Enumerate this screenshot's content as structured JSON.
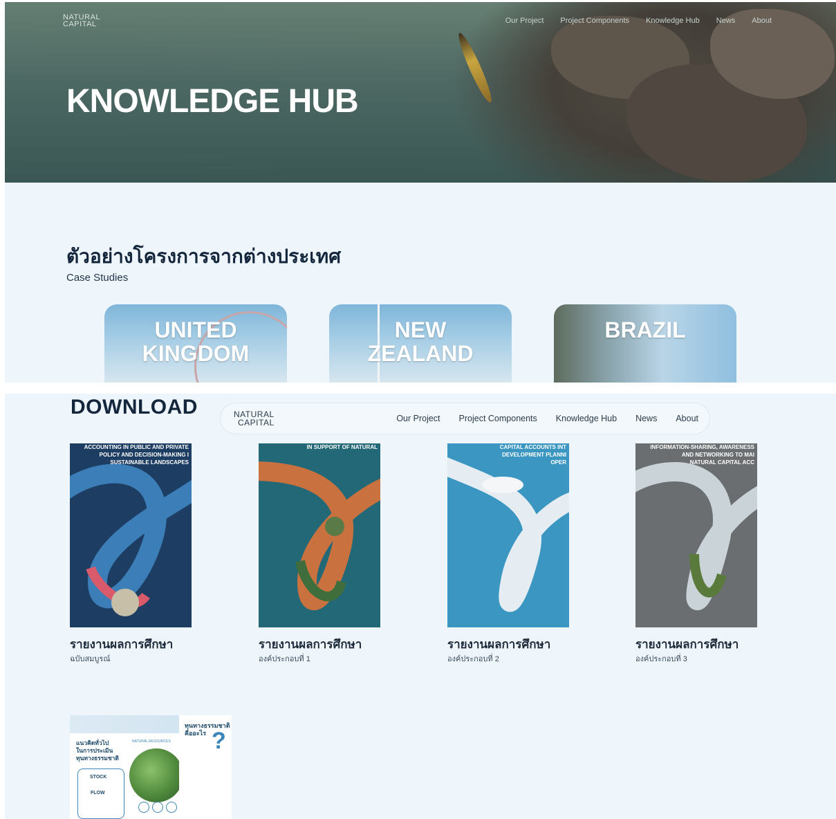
{
  "top": {
    "logo": {
      "line1": "NATURAL",
      "line2": "CAPITAL"
    },
    "nav": [
      "Our Project",
      "Project Components",
      "Knowledge Hub",
      "News",
      "About"
    ],
    "hero_title": "KNOWLEDGE HUB",
    "case_studies": {
      "title": "ตัวอย่างโครงการจากต่างประเทศ",
      "subtitle": "Case Studies",
      "cards": [
        {
          "line1": "UNITED",
          "line2": "KINGDOM"
        },
        {
          "line1": "NEW",
          "line2": "ZEALAND"
        },
        {
          "line1": "BRAZIL",
          "line2": ""
        }
      ]
    }
  },
  "bottom": {
    "download_title": "DOWNLOAD",
    "logo": {
      "line1": "NATURAL",
      "line2": "CAPITAL"
    },
    "nav": [
      "Our Project",
      "Project Components",
      "Knowledge Hub",
      "News",
      "About"
    ],
    "books": [
      {
        "cover_text": [
          "ACCOUNTING IN PUBLIC AND PRIVATE",
          "POLICY AND DECISION-MAKING I",
          "SUSTAINABLE LANDSCAPES"
        ],
        "title": "รายงานผลการศึกษา",
        "subtitle": "ฉบับสมบูรณ์"
      },
      {
        "cover_text": [
          "IN SUPPORT OF NATURAL"
        ],
        "title": "รายงานผลการศึกษา",
        "subtitle": "องค์ประกอบที่ 1"
      },
      {
        "cover_text": [
          "CAPITAL ACCOUNTS INT",
          "DEVELOPMENT PLANNI",
          "OPER"
        ],
        "title": "รายงานผลการศึกษา",
        "subtitle": "องค์ประกอบที่ 2"
      },
      {
        "cover_text": [
          "INFORMATION-SHARING, AWARENESS",
          "AND NETWORKING TO MAI",
          "NATURAL CAPITAL ACC"
        ],
        "title": "รายงานผลการศึกษา",
        "subtitle": "องค์ประกอบที่ 3"
      }
    ],
    "poster": {
      "left_title": [
        "แนวคิดทั่วไป",
        "ในการประเมิน",
        "ทุนทางธรรมชาติ"
      ],
      "right_title": [
        "ทุนทางธรรมชาติ",
        "คืออะไร"
      ],
      "qmark": "?",
      "natural_resources": "NATURAL RESOURCES",
      "stock": "STOCK",
      "flow": "FLOW"
    }
  }
}
